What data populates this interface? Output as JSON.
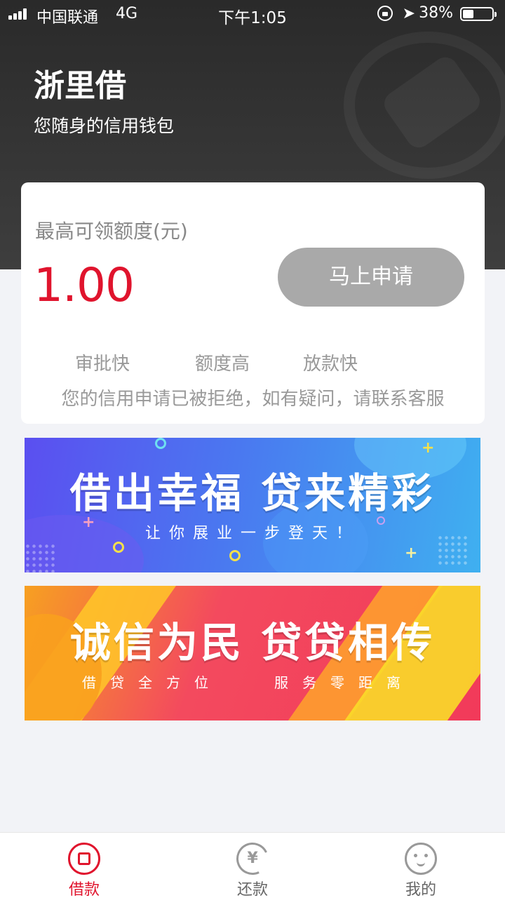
{
  "status_bar": {
    "carrier": "中国联通",
    "network": "4G",
    "time": "下午1:05",
    "battery_percent": "38%",
    "battery_level": 0.38
  },
  "header": {
    "title": "浙里借",
    "subtitle": "您随身的信用钱包"
  },
  "credit_card": {
    "limit_label": "最高可领额度(元)",
    "limit_value": "1.00",
    "apply_label": "马上申请",
    "features": [
      "审批快",
      "额度高",
      "放款快"
    ],
    "notice": "您的信用申请已被拒绝，如有疑问，请联系客服"
  },
  "banners": [
    {
      "title": "借出幸福 贷来精彩",
      "subtitle": "让你展业一步登天！"
    },
    {
      "title": "诚信为民 贷贷相传",
      "subtitle_left": "借贷全方位",
      "subtitle_right": "服务零距离"
    }
  ],
  "tab_bar": {
    "tabs": [
      {
        "label": "借款",
        "icon": "loan-icon",
        "active": true
      },
      {
        "label": "还款",
        "icon": "repay-icon",
        "active": false
      },
      {
        "label": "我的",
        "icon": "profile-icon",
        "active": false
      }
    ],
    "repay_symbol": "¥"
  },
  "colors": {
    "accent": "#e0142d",
    "header_bg": "#2f2f2f",
    "button_disabled": "#a9a9a9",
    "page_bg": "#f2f3f7"
  }
}
